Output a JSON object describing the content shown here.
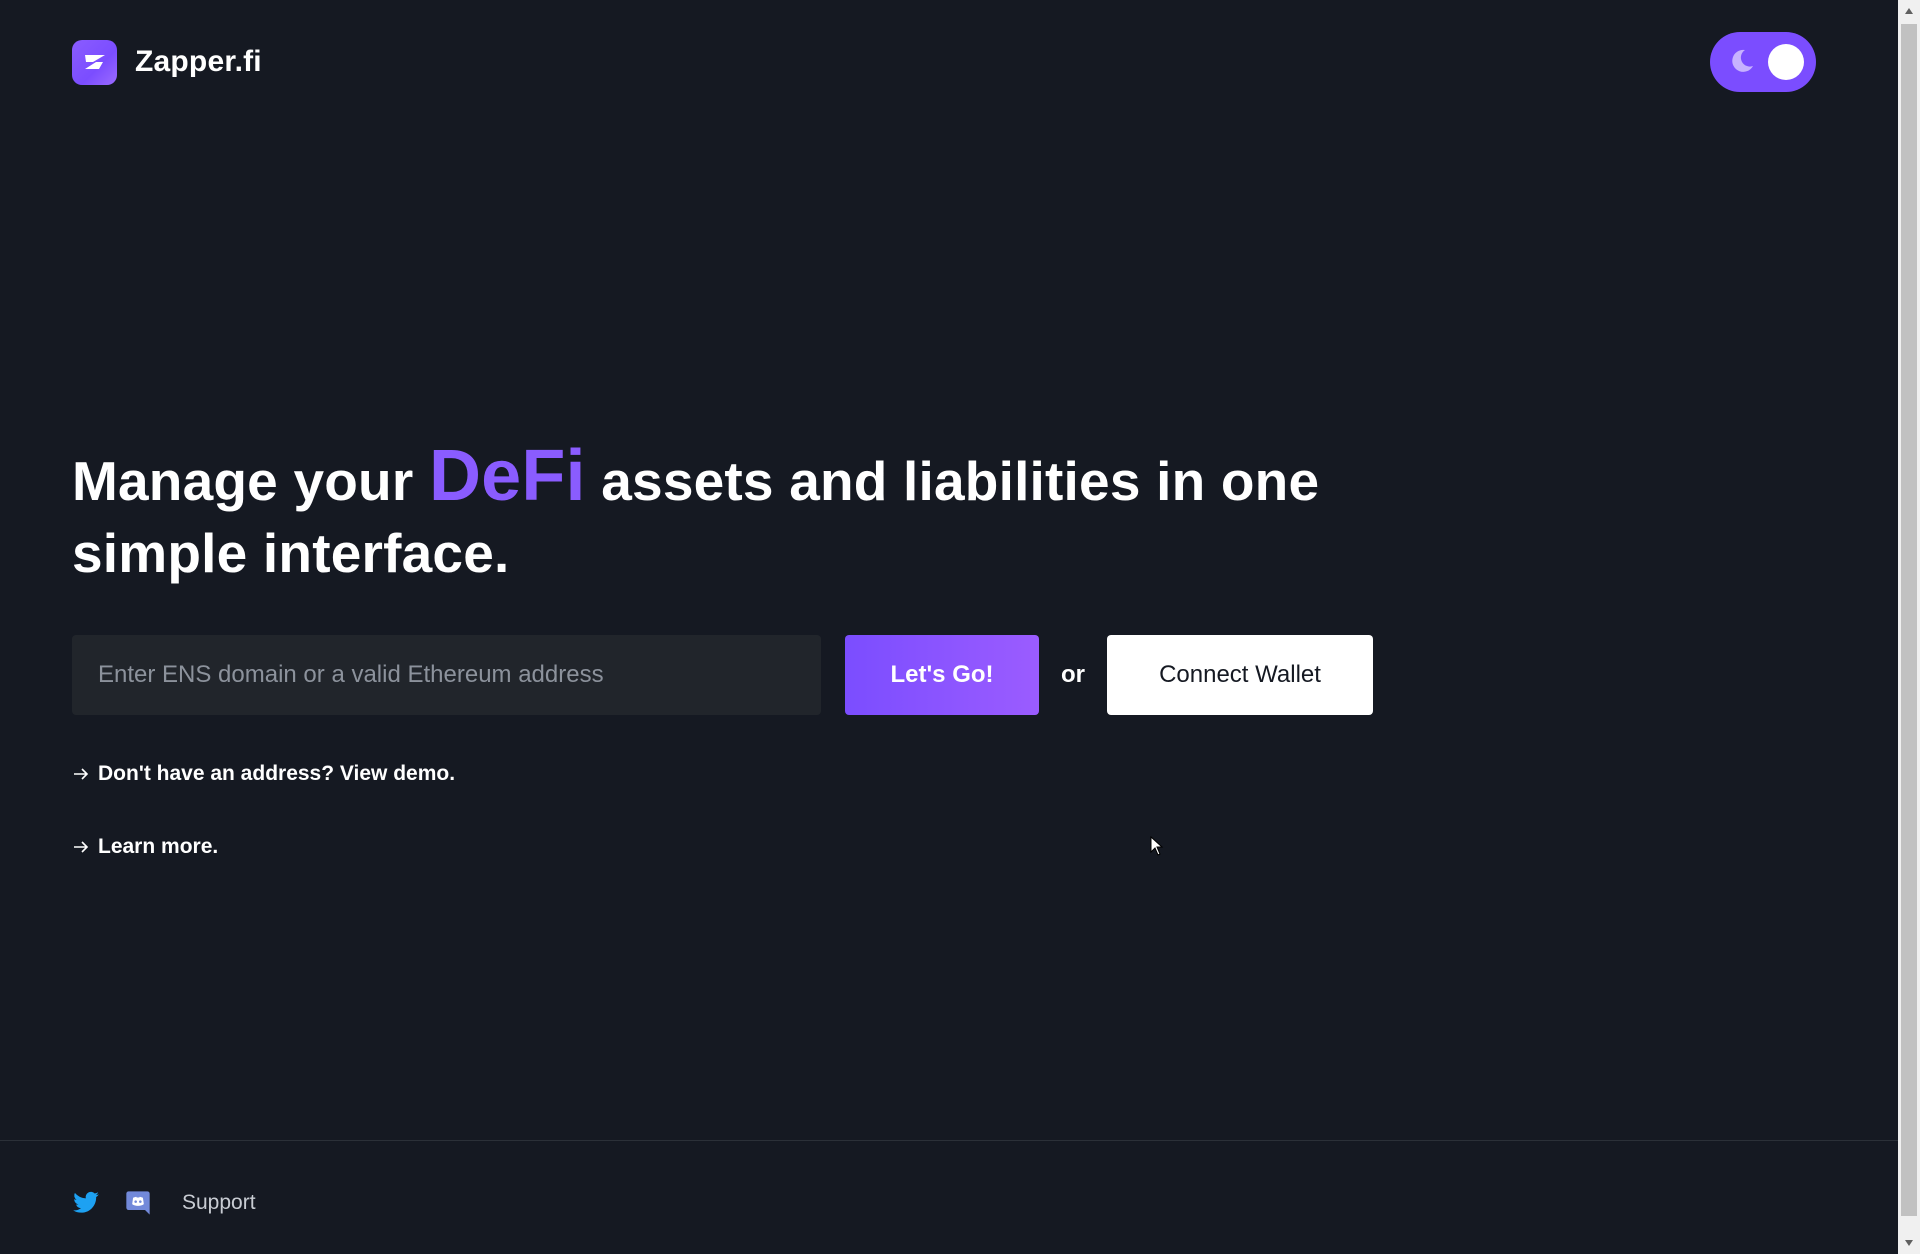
{
  "header": {
    "brand_name": "Zapper.fi",
    "logo_icon": "zapper-logo-icon",
    "theme_toggle": {
      "mode": "dark",
      "icon": "moon-icon"
    }
  },
  "hero": {
    "headline_before": "Manage your",
    "headline_accent": "DeFi",
    "headline_after": "assets and liabilities in one simple interface.",
    "accent_color": "#8a5cff"
  },
  "search": {
    "placeholder": "Enter ENS domain or a valid Ethereum address",
    "value": "",
    "go_label": "Let's Go!",
    "or_label": "or",
    "connect_label": "Connect Wallet"
  },
  "links": {
    "demo": "Don't have an address? View demo.",
    "learn": "Learn more."
  },
  "footer": {
    "twitter_icon": "twitter-icon",
    "discord_icon": "discord-icon",
    "support_label": "Support",
    "twitter_color": "#1da1f2",
    "discord_color": "#7289da"
  },
  "colors": {
    "background": "#151922",
    "accent": "#7b4dff",
    "input_bg": "#21252b"
  }
}
